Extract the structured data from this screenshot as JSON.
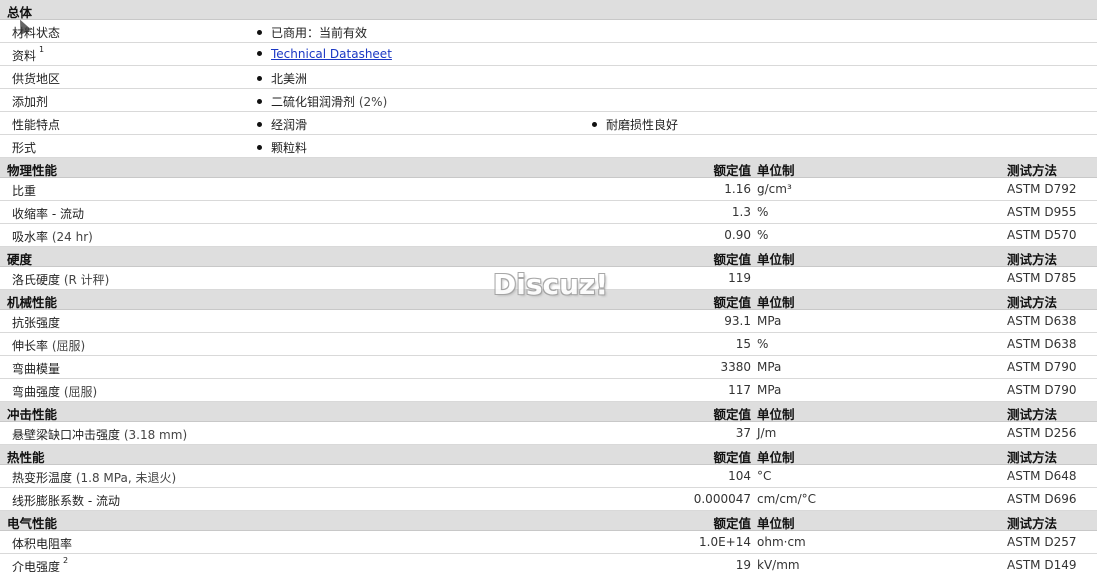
{
  "general": {
    "title": "总体",
    "rows": [
      {
        "label": "材料状态",
        "items": [
          "已商用：当前有效"
        ]
      },
      {
        "label": "资料",
        "sup": "1",
        "items": [
          "Technical Datasheet"
        ],
        "link": true
      },
      {
        "label": "供货地区",
        "items": [
          "北美洲"
        ]
      },
      {
        "label": "添加剂",
        "items": [
          "二硫化钼润滑剂",
          "(2%)"
        ]
      },
      {
        "label": "性能特点",
        "items": [
          "经润滑",
          "耐磨损性良好"
        ]
      },
      {
        "label": "形式",
        "items": [
          "颗粒料"
        ]
      }
    ]
  },
  "col_headers": {
    "nominal": "额定值",
    "unit": "单位制",
    "method": "测试方法"
  },
  "sections": [
    {
      "title": "物理性能",
      "rows": [
        {
          "label": "比重",
          "value": "1.16",
          "unit": "g/cm³",
          "method": "ASTM D792"
        },
        {
          "label": "收缩率  - 流动",
          "value": "1.3",
          "unit": "%",
          "method": "ASTM D955"
        },
        {
          "label": "吸水率",
          "note": "(24 hr)",
          "value": "0.90",
          "unit": "%",
          "method": "ASTM D570"
        }
      ]
    },
    {
      "title": "硬度",
      "rows": [
        {
          "label": "洛氏硬度",
          "note": "(R 计秤)",
          "value": "119",
          "unit": "",
          "method": "ASTM D785"
        }
      ]
    },
    {
      "title": "机械性能",
      "rows": [
        {
          "label": "抗张强度",
          "value": "93.1",
          "unit": "MPa",
          "method": "ASTM D638"
        },
        {
          "label": "伸长率",
          "note": "(屈服)",
          "value": "15",
          "unit": "%",
          "method": "ASTM D638"
        },
        {
          "label": "弯曲模量",
          "value": "3380",
          "unit": "MPa",
          "method": "ASTM D790"
        },
        {
          "label": "弯曲强度",
          "note": "(屈服)",
          "value": "117",
          "unit": "MPa",
          "method": "ASTM D790"
        }
      ]
    },
    {
      "title": "冲击性能",
      "rows": [
        {
          "label": "悬壁梁缺口冲击强度",
          "note": "(3.18 mm)",
          "value": "37",
          "unit": "J/m",
          "method": "ASTM D256"
        }
      ]
    },
    {
      "title": "热性能",
      "rows": [
        {
          "label": "热变形温度",
          "note": "(1.8 MPa, 未退火)",
          "value": "104",
          "unit": "°C",
          "method": "ASTM D648"
        },
        {
          "label": "线形膨胀系数  - 流动",
          "value": "0.000047",
          "unit": "cm/cm/°C",
          "method": "ASTM D696"
        }
      ]
    },
    {
      "title": "电气性能",
      "rows": [
        {
          "label": "体积电阻率",
          "value": "1.0E+14",
          "unit": "ohm·cm",
          "method": "ASTM D257"
        },
        {
          "label": "介电强度",
          "sup": "2",
          "value": "19",
          "unit": "kV/mm",
          "method": "ASTM D149"
        }
      ]
    }
  ],
  "watermark": "Discuz!"
}
